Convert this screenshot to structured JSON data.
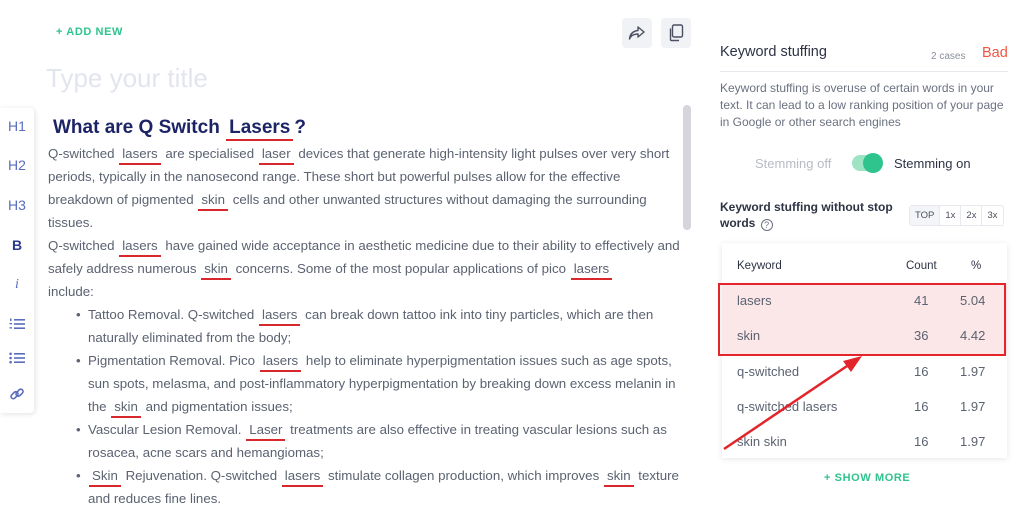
{
  "editor": {
    "add_new_label": "+ ADD NEW",
    "title_placeholder": "Type your title",
    "heading_prefix": "What are Q Switch",
    "heading_keyword": "Lasers",
    "heading_suffix": "?",
    "p1": {
      "t1": "Q-switched",
      "k1": "lasers",
      "t2": "are specialised",
      "k2": "laser",
      "t3": "devices that generate high-intensity light pulses over very short periods, typically in the nanosecond range. These short but powerful pulses allow for the effective breakdown of pigmented",
      "k3": "skin",
      "t4": "cells and other unwanted structures without damaging the surrounding tissues."
    },
    "p2": {
      "t1": "Q-switched",
      "k1": "lasers",
      "t2": "have gained wide acceptance in aesthetic medicine due to their ability to effectively and safely address numerous",
      "k2": "skin",
      "t3": "concerns. Some of the most popular applications of pico",
      "k3": "lasers",
      "t4": "include:"
    },
    "bullets": {
      "b1": {
        "t1": "Tattoo Removal. Q-switched",
        "k1": "lasers",
        "t2": "can break down tattoo ink into tiny particles, which are then naturally eliminated from the body;"
      },
      "b2": {
        "t1": "Pigmentation Removal. Pico",
        "k1": "lasers",
        "t2": "help to eliminate hyperpigmentation issues such as age spots, sun spots, melasma, and post-inflammatory hyperpigmentation by breaking down excess melanin in the",
        "k2": "skin",
        "t3": "and pigmentation issues;"
      },
      "b3": {
        "t1": "Vascular Lesion Removal.",
        "k1": "Laser",
        "t2": "treatments are also effective in treating vascular lesions such as rosacea, acne scars and hemangiomas;"
      },
      "b4": {
        "k1": "Skin",
        "t1": "Rejuvenation. Q-switched",
        "k2": "lasers",
        "t2": "stimulate collagen production, which improves",
        "k3": "skin",
        "t3": "texture and reduces fine lines."
      }
    }
  },
  "toolbar": {
    "h1": "H1",
    "h2": "H2",
    "h3": "H3",
    "bold": "B",
    "italic": "i"
  },
  "panel": {
    "title": "Keyword stuffing",
    "cases": "2 cases",
    "status": "Bad",
    "status_color": "#ee5544",
    "description": "Keyword stuffing is overuse of certain words in your text. It can lead to a low ranking position of your page in Google or other search engines",
    "stemming_off": "Stemming off",
    "stemming_on": "Stemming on",
    "stemming_enabled": true,
    "section_title": "Keyword stuffing without stop words",
    "tabs": [
      "TOP",
      "1x",
      "2x",
      "3x"
    ],
    "active_tab": "TOP",
    "table": {
      "headers": {
        "keyword": "Keyword",
        "count": "Count",
        "percent": "%"
      },
      "rows": [
        {
          "keyword": "lasers",
          "count": "41",
          "percent": "5.04",
          "highlighted": true
        },
        {
          "keyword": "skin",
          "count": "36",
          "percent": "4.42",
          "highlighted": true
        },
        {
          "keyword": "q-switched",
          "count": "16",
          "percent": "1.97",
          "highlighted": false
        },
        {
          "keyword": "q-switched lasers",
          "count": "16",
          "percent": "1.97",
          "highlighted": false
        },
        {
          "keyword": "skin skin",
          "count": "16",
          "percent": "1.97",
          "highlighted": false
        }
      ]
    },
    "show_more_label": "+ SHOW MORE"
  },
  "colors": {
    "accent_green": "#2fc48d",
    "keyword_underline": "#d9272e",
    "annotation_red": "#e3242b",
    "heading_navy": "#1c2466"
  }
}
